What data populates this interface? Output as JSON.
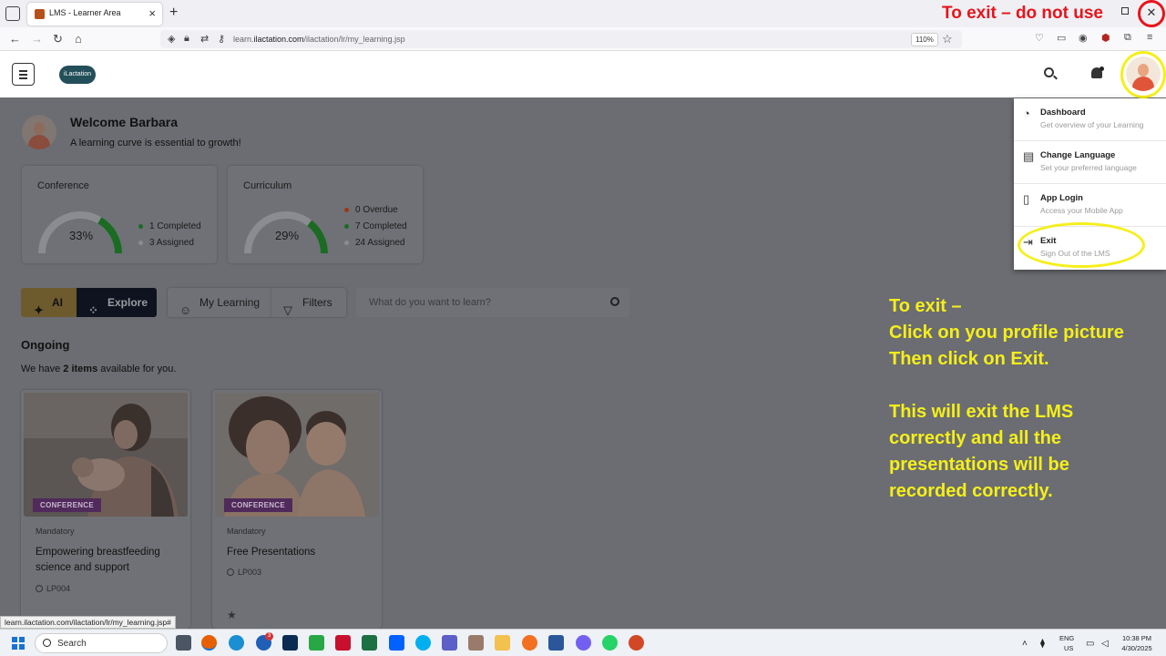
{
  "browser": {
    "tab_title": "LMS - Learner Area",
    "url_prefix": "learn.",
    "url_domain": "ilactation.com",
    "url_path": "/ilactation/lr/my_learning.jsp",
    "zoom": "110%",
    "status_url": "learn.ilactation.com/ilactation/lr/my_learning.jsp#"
  },
  "annotations": {
    "top_note": "To exit – do not use",
    "instructions": [
      "To exit –",
      "Click on you profile picture",
      "Then click on Exit.",
      "",
      "This will exit the LMS",
      "correctly and all the",
      "presentations will be",
      "recorded correctly."
    ]
  },
  "header": {
    "logo_text": "iLactation"
  },
  "welcome": {
    "title": "Welcome Barbara",
    "subtitle": "A learning curve is essential to growth!"
  },
  "stats": [
    {
      "title": "Conference",
      "percent": "33%",
      "fraction": 0.33,
      "legend": [
        {
          "text": "1 Completed",
          "color": "#1b6b23"
        },
        {
          "text": "3 Assigned",
          "color": "#8a8c90"
        }
      ]
    },
    {
      "title": "Curriculum",
      "percent": "29%",
      "fraction": 0.29,
      "legend": [
        {
          "text": "0 Overdue",
          "color": "#9a3a12"
        },
        {
          "text": "7 Completed",
          "color": "#1b6b23"
        },
        {
          "text": "24 Assigned",
          "color": "#8a8c90"
        }
      ]
    }
  ],
  "toolbar": {
    "ai_label": "AI",
    "explore_label": "Explore",
    "my_learning_label": "My Learning",
    "filters_label": "Filters",
    "search_placeholder": "What do you want to learn?"
  },
  "ongoing": {
    "title": "Ongoing",
    "sub_prefix": "We have ",
    "count": "2 items",
    "sub_suffix": " available for you."
  },
  "courses": [
    {
      "badge": "CONFERENCE",
      "type": "Mandatory",
      "title": "Empowering breastfeeding science and support",
      "code": "LP004"
    },
    {
      "badge": "CONFERENCE",
      "type": "Mandatory",
      "title": "Free Presentations",
      "code": "LP003"
    }
  ],
  "profile_menu": [
    {
      "label": "Dashboard",
      "sub": "Get overview of your Learning",
      "icon": "dashboard-icon"
    },
    {
      "label": "Change Language",
      "sub": "Set your preferred language",
      "icon": "language-icon"
    },
    {
      "label": "App Login",
      "sub": "Access your Mobile App",
      "icon": "mobile-icon"
    },
    {
      "label": "Exit",
      "sub": "Sign Out of the LMS",
      "icon": "exit-icon"
    }
  ],
  "taskbar": {
    "search_label": "Search",
    "notification_count": "3",
    "lang_top": "ENG",
    "lang_bottom": "US",
    "time": "10:38 PM",
    "date": "4/30/2025"
  },
  "colors": {
    "overlay": "#6b6d72",
    "note_red": "#e8141c",
    "highlight_yellow": "#f5ef1a",
    "badge_purple": "#4f2a5a",
    "gauge_green": "#1b6b23"
  }
}
